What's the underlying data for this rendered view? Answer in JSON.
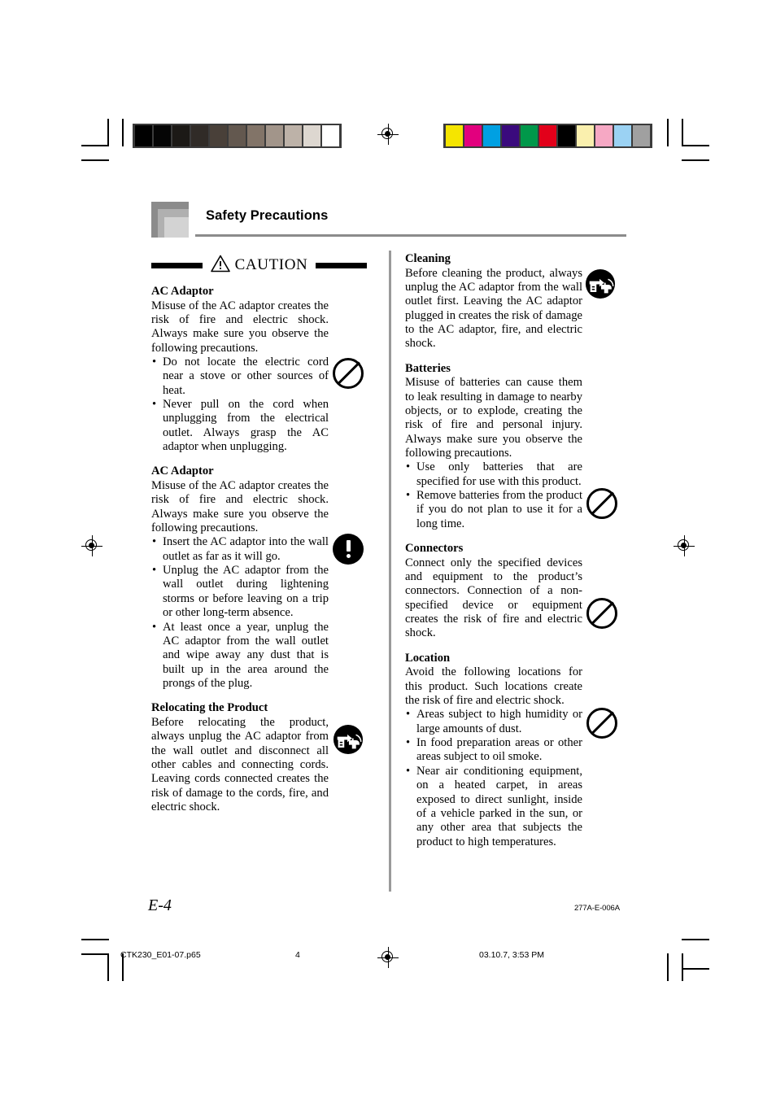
{
  "header": {
    "title": "Safety Precautions"
  },
  "caution": {
    "label": "CAUTION",
    "icon": "warning-triangle-icon"
  },
  "left_column": {
    "sections": [
      {
        "title": "AC Adaptor",
        "body": "Misuse of the AC adaptor creates the risk of fire and electric shock. Always make sure you observe the following precautions.",
        "bullets": [
          "Do not locate the electric cord near a stove or other sources of heat.",
          "Never pull on the cord when unplugging from the electrical outlet.  Always grasp the AC adaptor when unplugging."
        ],
        "icon": "prohibition-icon"
      },
      {
        "title": "AC Adaptor",
        "body": "Misuse of the AC adaptor creates the risk of fire and electric shock. Always make sure you observe the following precautions.",
        "bullets": [
          "Insert the AC adaptor into the wall outlet as far as it will go.",
          "Unplug the AC adaptor from the wall outlet during lightening storms or before leaving on a trip or other long-term absence.",
          "At least once a year, unplug the AC adaptor from the wall outlet and wipe away any dust that is built up in the area around the prongs of the plug."
        ],
        "icon": "exclamation-icon"
      },
      {
        "title": "Relocating the Product",
        "body": "Before relocating the product, always unplug the AC adaptor from the wall outlet and disconnect all other cables and connecting cords. Leaving cords connected creates the risk of damage to the cords, fire, and electric shock.",
        "bullets": [],
        "icon": "unplug-icon"
      }
    ]
  },
  "right_column": {
    "sections": [
      {
        "title": "Cleaning",
        "body": "Before cleaning the product, always unplug the AC adaptor from the wall outlet first. Leaving the AC adaptor plugged in creates the risk of damage to the AC adaptor, fire, and electric shock.",
        "bullets": [],
        "icon": "unplug-icon"
      },
      {
        "title": "Batteries",
        "body": "Misuse of batteries can cause them to leak resulting in damage to nearby objects, or to explode, creating the risk of fire and personal injury. Always make sure you observe the following precautions.",
        "bullets": [
          "Use only batteries that are specified for use with this product.",
          "Remove batteries from the product if you do not plan to use it for a long time."
        ],
        "icon": "prohibition-icon"
      },
      {
        "title": "Connectors",
        "body": "Connect only the specified devices and equipment to the product’s connectors. Connection of a non-specified device or equipment creates the risk of fire and electric shock.",
        "bullets": [],
        "icon": "prohibition-icon"
      },
      {
        "title": "Location",
        "body": "Avoid the following locations for this product. Such locations create the risk of fire and electric shock.",
        "bullets": [
          "Areas subject to high humidity or large amounts of dust.",
          "In food preparation areas or other areas subject to oil smoke.",
          "Near air conditioning equipment, on a heated carpet, in areas exposed to direct sunlight, inside of a vehicle parked in the sun, or any other area that subjects the product to high temperatures."
        ],
        "icon": "prohibition-icon"
      }
    ]
  },
  "footer": {
    "page_label": "E-4",
    "doc_code": "277A-E-006A"
  },
  "print_slug": {
    "file": "CTK230_E01-07.p65",
    "page": "4",
    "date": "03.10.7, 3:53 PM"
  },
  "calibration": {
    "grayscale": [
      "#000000",
      "#050505",
      "#1c1916",
      "#302b27",
      "#494039",
      "#63584f",
      "#827468",
      "#a2958a",
      "#bdb2a8",
      "#ddd7d0",
      "#ffffff"
    ],
    "colors": [
      "#f5e500",
      "#e2007e",
      "#00a0e2",
      "#3a0a7d",
      "#00984a",
      "#e2001a",
      "#000000",
      "#faf0ae",
      "#f6a8c4",
      "#9bd2f3",
      "#a0a0a0"
    ]
  }
}
